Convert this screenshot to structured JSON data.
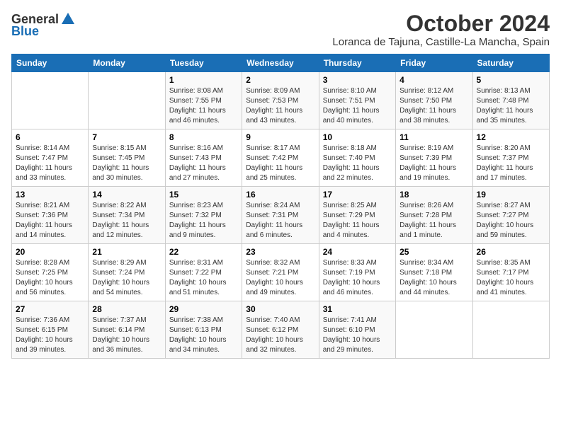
{
  "logo": {
    "general": "General",
    "blue": "Blue"
  },
  "title": "October 2024",
  "location": "Loranca de Tajuna, Castille-La Mancha, Spain",
  "weekdays": [
    "Sunday",
    "Monday",
    "Tuesday",
    "Wednesday",
    "Thursday",
    "Friday",
    "Saturday"
  ],
  "weeks": [
    [
      {
        "day": "",
        "detail": ""
      },
      {
        "day": "",
        "detail": ""
      },
      {
        "day": "1",
        "detail": "Sunrise: 8:08 AM\nSunset: 7:55 PM\nDaylight: 11 hours and 46 minutes."
      },
      {
        "day": "2",
        "detail": "Sunrise: 8:09 AM\nSunset: 7:53 PM\nDaylight: 11 hours and 43 minutes."
      },
      {
        "day": "3",
        "detail": "Sunrise: 8:10 AM\nSunset: 7:51 PM\nDaylight: 11 hours and 40 minutes."
      },
      {
        "day": "4",
        "detail": "Sunrise: 8:12 AM\nSunset: 7:50 PM\nDaylight: 11 hours and 38 minutes."
      },
      {
        "day": "5",
        "detail": "Sunrise: 8:13 AM\nSunset: 7:48 PM\nDaylight: 11 hours and 35 minutes."
      }
    ],
    [
      {
        "day": "6",
        "detail": "Sunrise: 8:14 AM\nSunset: 7:47 PM\nDaylight: 11 hours and 33 minutes."
      },
      {
        "day": "7",
        "detail": "Sunrise: 8:15 AM\nSunset: 7:45 PM\nDaylight: 11 hours and 30 minutes."
      },
      {
        "day": "8",
        "detail": "Sunrise: 8:16 AM\nSunset: 7:43 PM\nDaylight: 11 hours and 27 minutes."
      },
      {
        "day": "9",
        "detail": "Sunrise: 8:17 AM\nSunset: 7:42 PM\nDaylight: 11 hours and 25 minutes."
      },
      {
        "day": "10",
        "detail": "Sunrise: 8:18 AM\nSunset: 7:40 PM\nDaylight: 11 hours and 22 minutes."
      },
      {
        "day": "11",
        "detail": "Sunrise: 8:19 AM\nSunset: 7:39 PM\nDaylight: 11 hours and 19 minutes."
      },
      {
        "day": "12",
        "detail": "Sunrise: 8:20 AM\nSunset: 7:37 PM\nDaylight: 11 hours and 17 minutes."
      }
    ],
    [
      {
        "day": "13",
        "detail": "Sunrise: 8:21 AM\nSunset: 7:36 PM\nDaylight: 11 hours and 14 minutes."
      },
      {
        "day": "14",
        "detail": "Sunrise: 8:22 AM\nSunset: 7:34 PM\nDaylight: 11 hours and 12 minutes."
      },
      {
        "day": "15",
        "detail": "Sunrise: 8:23 AM\nSunset: 7:32 PM\nDaylight: 11 hours and 9 minutes."
      },
      {
        "day": "16",
        "detail": "Sunrise: 8:24 AM\nSunset: 7:31 PM\nDaylight: 11 hours and 6 minutes."
      },
      {
        "day": "17",
        "detail": "Sunrise: 8:25 AM\nSunset: 7:29 PM\nDaylight: 11 hours and 4 minutes."
      },
      {
        "day": "18",
        "detail": "Sunrise: 8:26 AM\nSunset: 7:28 PM\nDaylight: 11 hours and 1 minute."
      },
      {
        "day": "19",
        "detail": "Sunrise: 8:27 AM\nSunset: 7:27 PM\nDaylight: 10 hours and 59 minutes."
      }
    ],
    [
      {
        "day": "20",
        "detail": "Sunrise: 8:28 AM\nSunset: 7:25 PM\nDaylight: 10 hours and 56 minutes."
      },
      {
        "day": "21",
        "detail": "Sunrise: 8:29 AM\nSunset: 7:24 PM\nDaylight: 10 hours and 54 minutes."
      },
      {
        "day": "22",
        "detail": "Sunrise: 8:31 AM\nSunset: 7:22 PM\nDaylight: 10 hours and 51 minutes."
      },
      {
        "day": "23",
        "detail": "Sunrise: 8:32 AM\nSunset: 7:21 PM\nDaylight: 10 hours and 49 minutes."
      },
      {
        "day": "24",
        "detail": "Sunrise: 8:33 AM\nSunset: 7:19 PM\nDaylight: 10 hours and 46 minutes."
      },
      {
        "day": "25",
        "detail": "Sunrise: 8:34 AM\nSunset: 7:18 PM\nDaylight: 10 hours and 44 minutes."
      },
      {
        "day": "26",
        "detail": "Sunrise: 8:35 AM\nSunset: 7:17 PM\nDaylight: 10 hours and 41 minutes."
      }
    ],
    [
      {
        "day": "27",
        "detail": "Sunrise: 7:36 AM\nSunset: 6:15 PM\nDaylight: 10 hours and 39 minutes."
      },
      {
        "day": "28",
        "detail": "Sunrise: 7:37 AM\nSunset: 6:14 PM\nDaylight: 10 hours and 36 minutes."
      },
      {
        "day": "29",
        "detail": "Sunrise: 7:38 AM\nSunset: 6:13 PM\nDaylight: 10 hours and 34 minutes."
      },
      {
        "day": "30",
        "detail": "Sunrise: 7:40 AM\nSunset: 6:12 PM\nDaylight: 10 hours and 32 minutes."
      },
      {
        "day": "31",
        "detail": "Sunrise: 7:41 AM\nSunset: 6:10 PM\nDaylight: 10 hours and 29 minutes."
      },
      {
        "day": "",
        "detail": ""
      },
      {
        "day": "",
        "detail": ""
      }
    ]
  ]
}
